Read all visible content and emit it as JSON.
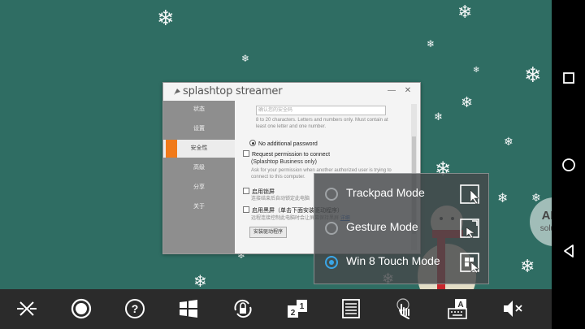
{
  "window": {
    "title": "splashtop streamer",
    "minimize": "—",
    "close": "✕",
    "sidebar": [
      {
        "label": "状态"
      },
      {
        "label": "设置"
      },
      {
        "label": "安全性"
      },
      {
        "label": "高级"
      },
      {
        "label": "分享"
      },
      {
        "label": "关于"
      }
    ],
    "password_placeholder": "确认您的安全码",
    "password_hint": "8 to 20 characters. Letters and numbers only. Must contain at least one letter and one number.",
    "option_no_password": "No additional password",
    "option_request_permission": "Request permission to connect",
    "option_request_permission_sub1": "(Splashtop Business only)",
    "option_request_permission_sub2": "Ask for your permission when another authorized user is trying to connect to this computer.",
    "option_lock": "启用锁屏",
    "option_lock_sub": "连接结束后自动锁定此电脑",
    "option_blank": "启用黑屏（单击下面安装驱动程序）",
    "option_blank_sub": "远程连接控制此电脑时会让屏幕保持黑屏",
    "option_blank_link": "详细",
    "install_button": "安装驱动程序"
  },
  "modes": [
    {
      "label": "Trackpad Mode",
      "selected": false,
      "icon": "trackpad-mode-icon"
    },
    {
      "label": "Gesture Mode",
      "selected": false,
      "icon": "gesture-mode-icon"
    },
    {
      "label": "Win 8 Touch Mode",
      "selected": true,
      "icon": "win8-touch-mode-icon"
    }
  ],
  "watermark": {
    "line1": "APP",
    "line2": "solution"
  },
  "toolbar": [
    {
      "icon": "disconnect-icon"
    },
    {
      "icon": "record-icon"
    },
    {
      "icon": "help-icon"
    },
    {
      "icon": "windows-icon"
    },
    {
      "icon": "rotation-lock-icon"
    },
    {
      "icon": "monitor-switch-icon"
    },
    {
      "icon": "menu-list-icon"
    },
    {
      "icon": "touch-mode-icon"
    },
    {
      "icon": "keyboard-icon"
    },
    {
      "icon": "mute-icon"
    }
  ],
  "navbar": [
    "recent-apps-icon",
    "home-icon",
    "back-icon"
  ],
  "colors": {
    "desktop": "#2f6d63",
    "accent": "#f07a1a",
    "selected_mode": "#3aa7e8",
    "toolbar": "#2b2b2b"
  }
}
